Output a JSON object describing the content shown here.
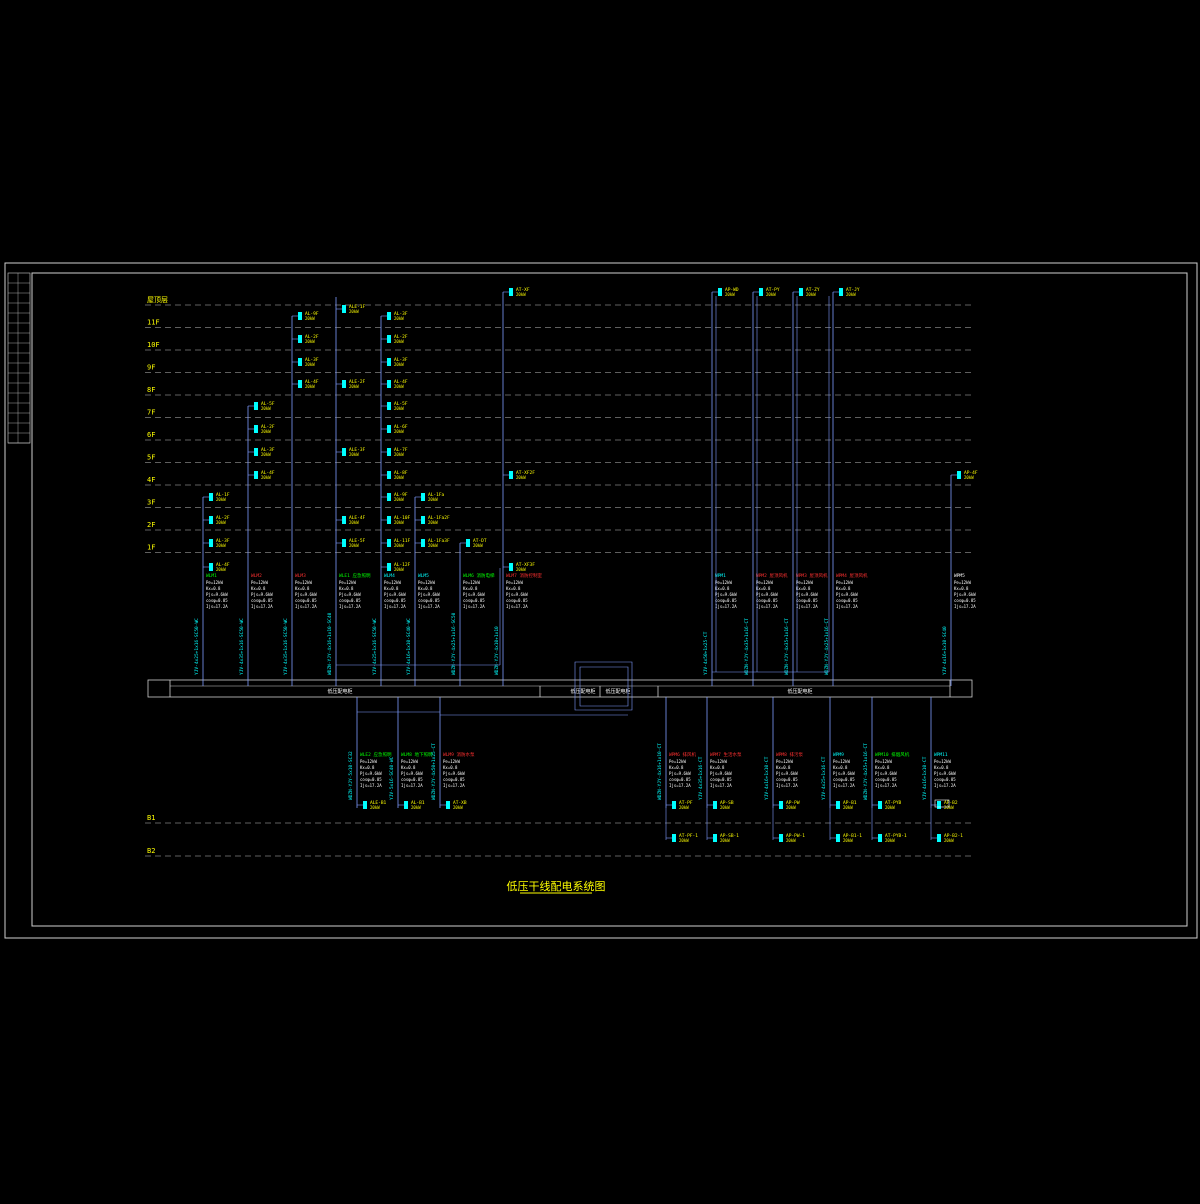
{
  "diagram": {
    "title": "低压干线配电系统图",
    "colors": {
      "frame": "#cfcfcf",
      "floor_line": "#bdbdbd",
      "floor_label": "#ffff00",
      "riser": "#7f9cff",
      "label_yellow": "#ffff00",
      "label_cyan": "#00ffff",
      "label_green": "#00ff00",
      "label_red": "#ff3030",
      "label_white": "#ffffff",
      "bus": "#cfcfcf"
    },
    "floors_top": [
      "屋顶层",
      "11F",
      "10F",
      "9F",
      "8F",
      "7F",
      "6F",
      "5F",
      "4F",
      "3F",
      "2F",
      "1F"
    ],
    "floors_bottom": [
      "B1",
      "B2"
    ],
    "bus_labels": [
      "低压配电柜",
      "低压配电柜",
      "低压配电柜",
      "低压配电柜"
    ],
    "upper_circuits": [
      {
        "header": "WLM1",
        "header_color": "green",
        "cable": "YJV-4x25+1x16-SC50-WC",
        "box": "AL-1F"
      },
      {
        "header": "WLM2",
        "header_color": "red",
        "cable": "YJV-4x35+1x16-SC50-WC",
        "box": "AL-5F"
      },
      {
        "header": "WLM3",
        "header_color": "red",
        "cable": "YJV-4x35+1x16-SC50-WC",
        "box": "AL-9F"
      },
      {
        "header": "WLE1 应急照明",
        "header_color": "green",
        "cable": "WDZN-YJY-4x16+1x10-SC40",
        "box": "ALE-1F"
      },
      {
        "header": "WLM4",
        "header_color": "cyan",
        "cable": "YJV-4x25+1x16-SC50-WC",
        "box": "AL-3F"
      },
      {
        "header": "WLM5",
        "header_color": "cyan",
        "cable": "YJV-4x16+1x10-SC40-WC",
        "box": "AL-1Fa"
      },
      {
        "header": "WLM6 消防电梯",
        "header_color": "green",
        "cable": "WDZN-YJY-4x25+1x16-SC50",
        "box": "AT-DT"
      },
      {
        "header": "WLM7 消防控制室",
        "header_color": "red",
        "cable": "WDZN-YJY-4x10+1x10",
        "box": "AT-XF"
      },
      {
        "header": "WPM1",
        "header_color": "cyan",
        "cable": "YJV-4x50+1x25-CT",
        "box": "AP-WD"
      },
      {
        "header": "WPM2 屋顶风机",
        "header_color": "red",
        "cable": "WDZN-YJY-4x35+1x16-CT",
        "box": "AT-PY"
      },
      {
        "header": "WPM3 屋顶风机",
        "header_color": "red",
        "cable": "WDZN-YJY-4x35+1x16-CT",
        "box": "AT-ZY"
      },
      {
        "header": "WPM4 屋顶风机",
        "header_color": "red",
        "cable": "WDZN-YJY-4x25+1x16-CT",
        "box": "AT-JY"
      },
      {
        "header": "WPM5",
        "header_color": "white",
        "cable": "YJV-4x16+1x10-SC40",
        "box": "AP-4F"
      }
    ],
    "lower_circuits": [
      {
        "header": "WLE2 应急照明",
        "header_color": "green",
        "cable": "WDZN-YJY-5x10-SC32",
        "box": "ALE-B1"
      },
      {
        "header": "WLM8 地下照明",
        "header_color": "green",
        "cable": "YJV-5x16-SC40-WC",
        "box": "AL-B1"
      },
      {
        "header": "WLM9 消防水泵",
        "header_color": "red",
        "cable": "WDZN-YJY-4x50+1x25-CT",
        "box": "AT-XB"
      },
      {
        "header": "WPM6 排风机",
        "header_color": "red",
        "cable": "WDZN-YJY-4x16+1x10-CT",
        "box": "AT-PF"
      },
      {
        "header": "WPM7 生活水泵",
        "header_color": "red",
        "cable": "YJV-4x35+1x16-CT",
        "box": "AP-SB"
      },
      {
        "header": "WPM8 排污泵",
        "header_color": "red",
        "cable": "YJV-4x16+1x10-CT",
        "box": "AP-PW"
      },
      {
        "header": "WPM9",
        "header_color": "cyan",
        "cable": "YJV-4x25+1x16-CT",
        "box": "AP-B1"
      },
      {
        "header": "WPM10 排烟风机",
        "header_color": "green",
        "cable": "WDZN-YJY-4x25+1x16-CT",
        "box": "AT-PYB"
      },
      {
        "header": "WPM11",
        "header_color": "cyan",
        "cable": "YJV-4x16+1x10-CT",
        "box": "AP-B2"
      }
    ],
    "calc_lines": [
      "Pe=12kW",
      "Kx=0.8",
      "Pjs=9.6kW",
      "cosφ=0.85",
      "Ijs=17.2A"
    ]
  }
}
